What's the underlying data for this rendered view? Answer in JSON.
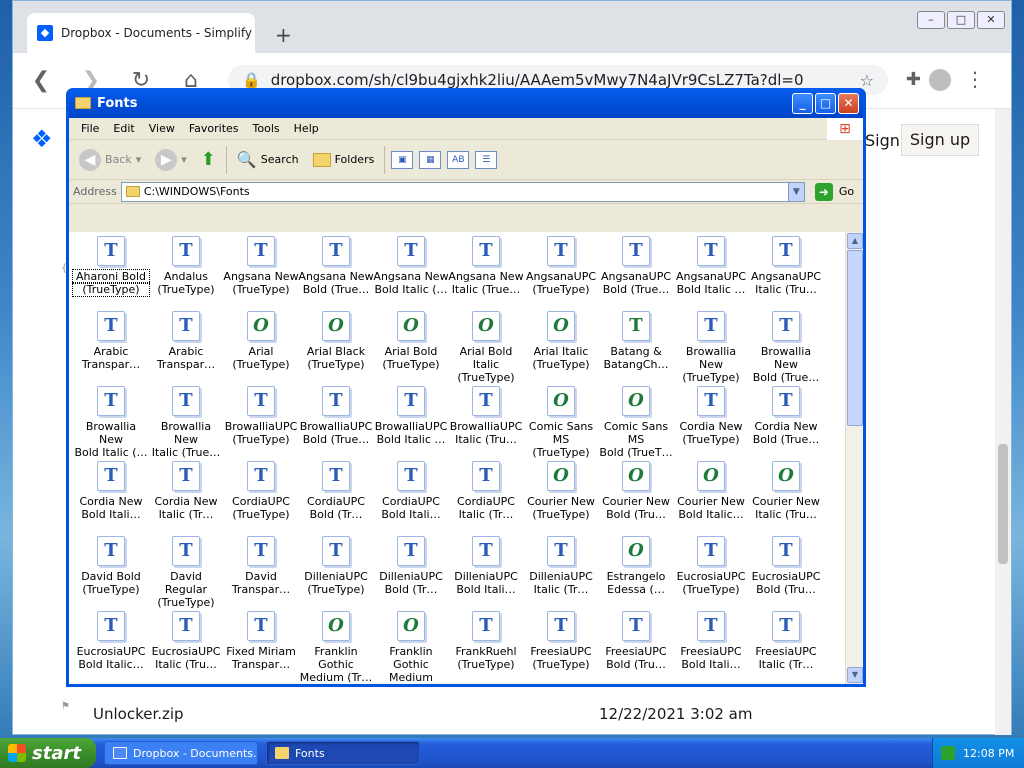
{
  "browser": {
    "tab_title": "Dropbox - Documents - Simplify your",
    "url": "dropbox.com/sh/cl9bu4gjxhk2liu/AAAem5vMwy7N4aJVr9CsLZ7Ta?dl=0",
    "sign_in": "Sign in",
    "sign_up": "Sign up",
    "file_name": "Unlocker.zip",
    "file_date": "12/22/2021 3:02 am"
  },
  "window": {
    "title": "Fonts",
    "menu": [
      "File",
      "Edit",
      "View",
      "Favorites",
      "Tools",
      "Help"
    ],
    "toolbar": {
      "back": "Back",
      "search": "Search",
      "folders": "Folders"
    },
    "address_label": "Address",
    "address": "C:\\WINDOWS\\Fonts",
    "go": "Go"
  },
  "fonts": [
    {
      "l1": "Aharoni Bold",
      "l2": "(TrueType)",
      "icon": "T"
    },
    {
      "l1": "Andalus",
      "l2": "(TrueType)",
      "icon": "T"
    },
    {
      "l1": "Angsana New",
      "l2": "(TrueType)",
      "icon": "T"
    },
    {
      "l1": "Angsana New",
      "l2": "Bold (True…",
      "icon": "T"
    },
    {
      "l1": "Angsana New",
      "l2": "Bold Italic (…",
      "icon": "T"
    },
    {
      "l1": "Angsana New",
      "l2": "Italic (True…",
      "icon": "T"
    },
    {
      "l1": "AngsanaUPC",
      "l2": "(TrueType)",
      "icon": "T"
    },
    {
      "l1": "AngsanaUPC",
      "l2": "Bold (True…",
      "icon": "T"
    },
    {
      "l1": "AngsanaUPC",
      "l2": "Bold Italic …",
      "icon": "T"
    },
    {
      "l1": "AngsanaUPC",
      "l2": "Italic (Tru…",
      "icon": "T"
    },
    {
      "l1": "Arabic",
      "l2": "Transpar…",
      "icon": "T"
    },
    {
      "l1": "Arabic",
      "l2": "Transpar…",
      "icon": "T"
    },
    {
      "l1": "Arial",
      "l2": "(TrueType)",
      "icon": "O"
    },
    {
      "l1": "Arial Black",
      "l2": "(TrueType)",
      "icon": "O"
    },
    {
      "l1": "Arial Bold",
      "l2": "(TrueType)",
      "icon": "O"
    },
    {
      "l1": "Arial Bold Italic",
      "l2": "(TrueType)",
      "icon": "O"
    },
    {
      "l1": "Arial Italic",
      "l2": "(TrueType)",
      "icon": "O"
    },
    {
      "l1": "Batang &",
      "l2": "BatangCh…",
      "icon": "TG"
    },
    {
      "l1": "Browallia New",
      "l2": "(TrueType)",
      "icon": "T"
    },
    {
      "l1": "Browallia New",
      "l2": "Bold (True…",
      "icon": "T"
    },
    {
      "l1": "Browallia New",
      "l2": "Bold Italic (…",
      "icon": "T"
    },
    {
      "l1": "Browallia New",
      "l2": "Italic (True…",
      "icon": "T"
    },
    {
      "l1": "BrowalliaUPC",
      "l2": "(TrueType)",
      "icon": "T"
    },
    {
      "l1": "BrowalliaUPC",
      "l2": "Bold (True…",
      "icon": "T"
    },
    {
      "l1": "BrowalliaUPC",
      "l2": "Bold Italic …",
      "icon": "T"
    },
    {
      "l1": "BrowalliaUPC",
      "l2": "Italic (Tru…",
      "icon": "T"
    },
    {
      "l1": "Comic Sans MS",
      "l2": "(TrueType)",
      "icon": "O"
    },
    {
      "l1": "Comic Sans MS",
      "l2": "Bold (TrueT…",
      "icon": "O"
    },
    {
      "l1": "Cordia New",
      "l2": "(TrueType)",
      "icon": "T"
    },
    {
      "l1": "Cordia New",
      "l2": "Bold (True…",
      "icon": "T"
    },
    {
      "l1": "Cordia New",
      "l2": "Bold Itali…",
      "icon": "T"
    },
    {
      "l1": "Cordia New",
      "l2": "Italic (Tr…",
      "icon": "T"
    },
    {
      "l1": "CordiaUPC",
      "l2": "(TrueType)",
      "icon": "T"
    },
    {
      "l1": "CordiaUPC",
      "l2": "Bold (Tr…",
      "icon": "T"
    },
    {
      "l1": "CordiaUPC",
      "l2": "Bold Itali…",
      "icon": "T"
    },
    {
      "l1": "CordiaUPC",
      "l2": "Italic (Tr…",
      "icon": "T"
    },
    {
      "l1": "Courier New",
      "l2": "(TrueType)",
      "icon": "O"
    },
    {
      "l1": "Courier New",
      "l2": "Bold (Tru…",
      "icon": "O"
    },
    {
      "l1": "Courier New",
      "l2": "Bold Italic…",
      "icon": "O"
    },
    {
      "l1": "Courier New",
      "l2": "Italic (Tru…",
      "icon": "O"
    },
    {
      "l1": "David Bold",
      "l2": "(TrueType)",
      "icon": "T"
    },
    {
      "l1": "David Regular",
      "l2": "(TrueType)",
      "icon": "T"
    },
    {
      "l1": "David",
      "l2": "Transpar…",
      "icon": "T"
    },
    {
      "l1": "DilleniaUPC",
      "l2": "(TrueType)",
      "icon": "T"
    },
    {
      "l1": "DilleniaUPC",
      "l2": "Bold (Tr…",
      "icon": "T"
    },
    {
      "l1": "DilleniaUPC",
      "l2": "Bold Itali…",
      "icon": "T"
    },
    {
      "l1": "DilleniaUPC",
      "l2": "Italic (Tr…",
      "icon": "T"
    },
    {
      "l1": "Estrangelo",
      "l2": "Edessa (…",
      "icon": "O"
    },
    {
      "l1": "EucrosiaUPC",
      "l2": "(TrueType)",
      "icon": "T"
    },
    {
      "l1": "EucrosiaUPC",
      "l2": "Bold (Tru…",
      "icon": "T"
    },
    {
      "l1": "EucrosiaUPC",
      "l2": "Bold Italic…",
      "icon": "T"
    },
    {
      "l1": "EucrosiaUPC",
      "l2": "Italic (Tru…",
      "icon": "T"
    },
    {
      "l1": "Fixed Miriam",
      "l2": "Transpar…",
      "icon": "T"
    },
    {
      "l1": "Franklin Gothic",
      "l2": "Medium (Tr…",
      "icon": "O"
    },
    {
      "l1": "Franklin Gothic",
      "l2": "Medium Itali…",
      "icon": "O"
    },
    {
      "l1": "FrankRuehl",
      "l2": "(TrueType)",
      "icon": "T"
    },
    {
      "l1": "FreesiaUPC",
      "l2": "(TrueType)",
      "icon": "T"
    },
    {
      "l1": "FreesiaUPC",
      "l2": "Bold (Tru…",
      "icon": "T"
    },
    {
      "l1": "FreesiaUPC",
      "l2": "Bold Itali…",
      "icon": "T"
    },
    {
      "l1": "FreesiaUPC",
      "l2": "Italic (Tr…",
      "icon": "T"
    },
    {
      "l1": "",
      "l2": "",
      "icon": "O"
    },
    {
      "l1": "",
      "l2": "",
      "icon": "O"
    },
    {
      "l1": "",
      "l2": "",
      "icon": "O"
    },
    {
      "l1": "",
      "l2": "",
      "icon": "O"
    },
    {
      "l1": "",
      "l2": "",
      "icon": "O"
    },
    {
      "l1": "",
      "l2": "",
      "icon": "A"
    },
    {
      "l1": "",
      "l2": "",
      "icon": "A"
    },
    {
      "l1": "",
      "l2": "",
      "icon": "A"
    },
    {
      "l1": "",
      "l2": "",
      "icon": "A"
    },
    {
      "l1": "",
      "l2": "",
      "icon": "TG"
    }
  ],
  "taskbar": {
    "start": "start",
    "task1": "Dropbox - Documents...",
    "task2": "Fonts",
    "clock": "12:08 PM"
  }
}
